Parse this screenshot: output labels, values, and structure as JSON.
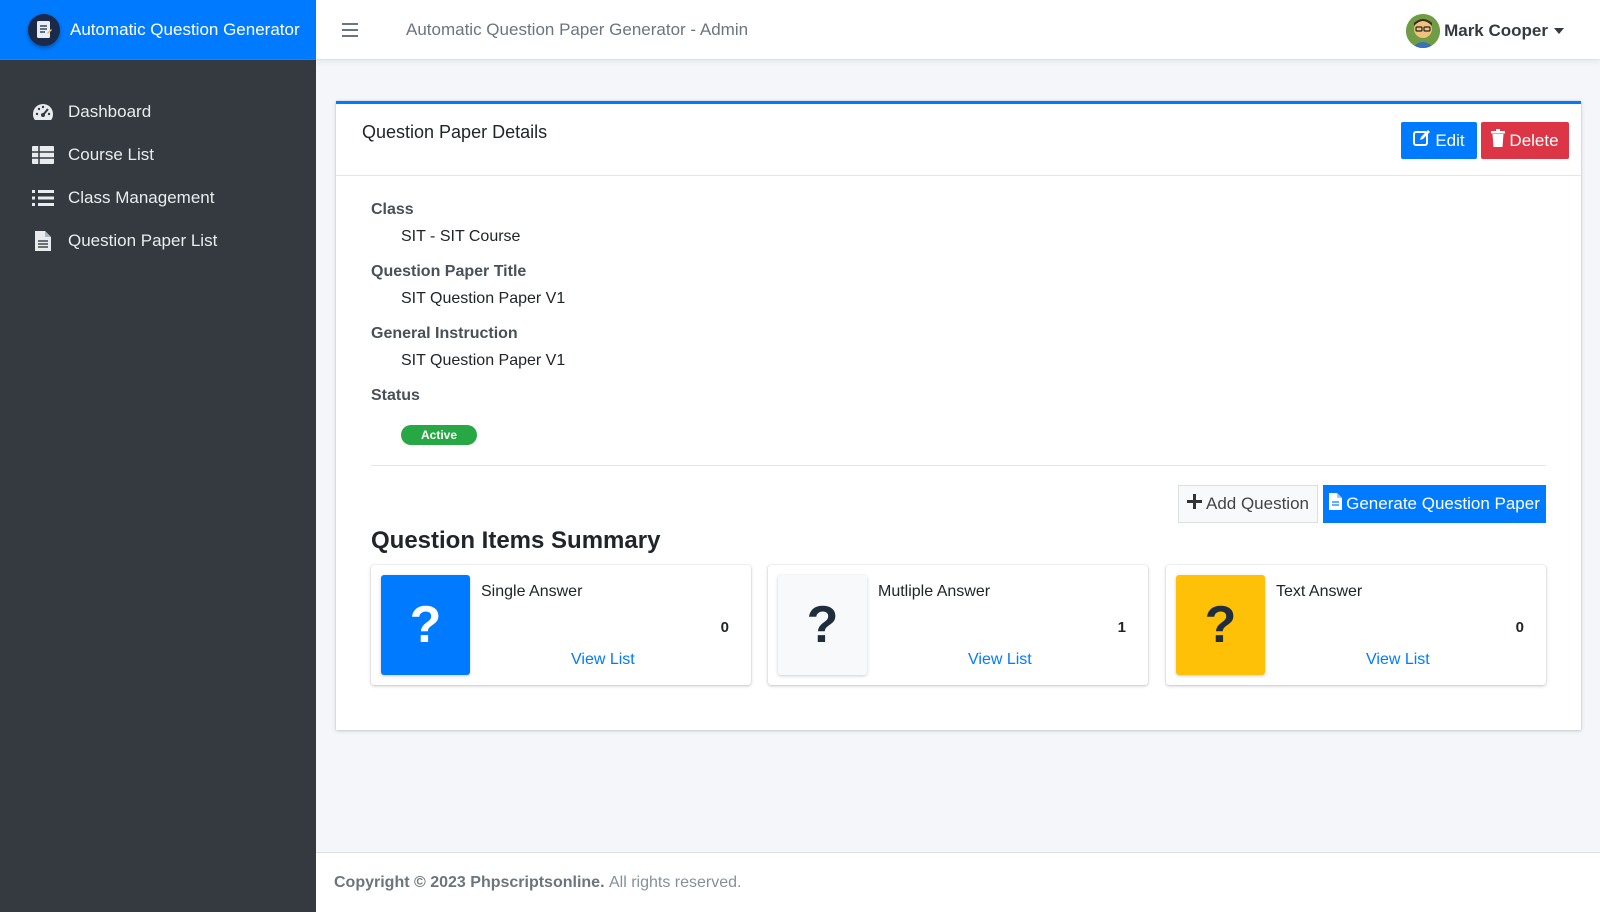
{
  "brand": {
    "title": "Automatic Question Generator"
  },
  "sidebar": {
    "items": [
      {
        "label": "Dashboard",
        "icon": "gauge-icon"
      },
      {
        "label": "Course List",
        "icon": "table-icon"
      },
      {
        "label": "Class Management",
        "icon": "list-icon"
      },
      {
        "label": "Question Paper List",
        "icon": "file-icon"
      }
    ]
  },
  "topbar": {
    "title": "Automatic Question Paper Generator - Admin",
    "user_name": "Mark Cooper"
  },
  "card": {
    "title": "Question Paper Details",
    "edit_label": "Edit",
    "delete_label": "Delete"
  },
  "details": {
    "class_label": "Class",
    "class_value": "SIT - SIT Course",
    "title_label": "Question Paper Title",
    "title_value": "SIT Question Paper V1",
    "instruction_label": "General Instruction",
    "instruction_value": "SIT Question Paper V1",
    "status_label": "Status",
    "status_value": "Active"
  },
  "actions": {
    "add_question": "Add Question",
    "generate": "Generate Question Paper"
  },
  "summary": {
    "title": "Question Items Summary",
    "boxes": [
      {
        "label": "Single Answer",
        "count": "0",
        "link": "View List",
        "color": "#007bff",
        "icon": "question-icon"
      },
      {
        "label": "Mutliple Answer",
        "count": "1",
        "link": "View List",
        "color": "#f8f9fa",
        "icon": "question-icon"
      },
      {
        "label": "Text Answer",
        "count": "0",
        "link": "View List",
        "color": "#ffc107",
        "icon": "question-icon"
      }
    ]
  },
  "footer": {
    "copyright": "Copyright © 2023 Phpscriptsonline.",
    "rights": "All rights reserved."
  },
  "colors": {
    "primary": "#007bff",
    "danger": "#dc3545",
    "success": "#28a745",
    "warning": "#ffc107",
    "sidebar": "#343a40"
  }
}
